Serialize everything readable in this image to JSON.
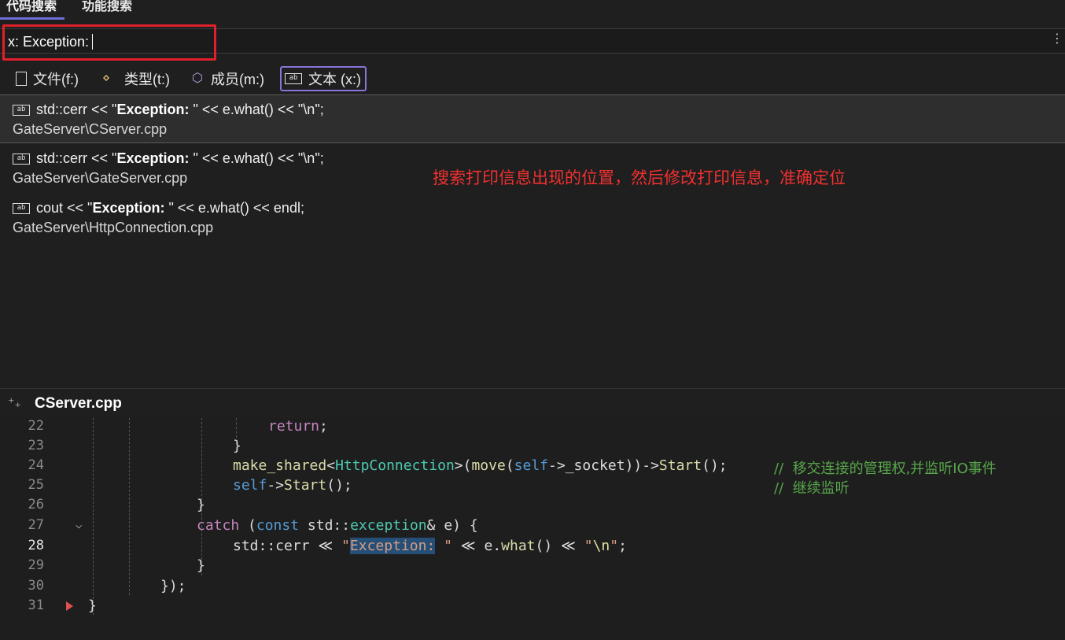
{
  "tabs": {
    "code_search": "代码搜索",
    "feature_search": "功能搜索"
  },
  "search": {
    "value": "x: Exception:",
    "more": "⋮"
  },
  "filters": [
    {
      "label": "文件(f:)",
      "icon": "file-icon"
    },
    {
      "label": "类型(t:)",
      "icon": "type-icon"
    },
    {
      "label": "成员(m:)",
      "icon": "member-cube-icon"
    },
    {
      "label": "文本 (x:)",
      "icon": "text-icon",
      "selected": true
    }
  ],
  "results": [
    {
      "pre": "std::cerr << \"",
      "bold": "Exception:",
      "post": " \" << e.what() << \"\\n\";",
      "path": "GateServer\\CServer.cpp"
    },
    {
      "pre": "std::cerr << \"",
      "bold": "Exception:",
      "post": " \" << e.what() << \"\\n\";",
      "path": "GateServer\\GateServer.cpp"
    },
    {
      "pre": "cout << \"",
      "bold": "Exception:",
      "post": " \" << e.what() << endl;",
      "path": "GateServer\\HttpConnection.cpp"
    }
  ],
  "icon_text": "ab",
  "annotation": "搜索打印信息出现的位置，然后修改打印信息，准确定位",
  "editor": {
    "pin": "⁺₊",
    "file_name": "CServer.cpp",
    "line_numbers": [
      "22",
      "23",
      "24",
      "25",
      "26",
      "27",
      "28",
      "29",
      "30",
      "31"
    ],
    "fold_glyph": "⌵",
    "code": {
      "l22_return": "return",
      "l22_semi": ";",
      "l23": "}",
      "l24_a": "make_shared",
      "l24_b": "<",
      "l24_c": "HttpConnection",
      "l24_d": ">(",
      "l24_e": "move",
      "l24_f": "(",
      "l24_g": "self",
      "l24_h": "->_socket))->",
      "l24_i": "Start",
      "l24_j": "();",
      "l24_comment": "//  移交连接的管理权,并监听IO事件",
      "l25_a": "self",
      "l25_b": "->",
      "l25_c": "Start",
      "l25_d": "();",
      "l25_comment": "//  继续监听",
      "l26": "}",
      "l27_catch": "catch",
      "l27_a": " (",
      "l27_const": "const",
      "l27_b": " std::",
      "l27_exc": "exception",
      "l27_c": "& e) {",
      "l28_a": "std::cerr ≪ ",
      "l28_q1": "\"",
      "l28_match": "Exception:",
      "l28_q2": " \"",
      "l28_b": " ≪ e.",
      "l28_what": "what",
      "l28_c": "() ≪ ",
      "l28_s1": "\"",
      "l28_esc": "\\n",
      "l28_s2": "\"",
      "l28_d": ";",
      "l29": "}",
      "l30": "});",
      "l31": "}"
    }
  }
}
